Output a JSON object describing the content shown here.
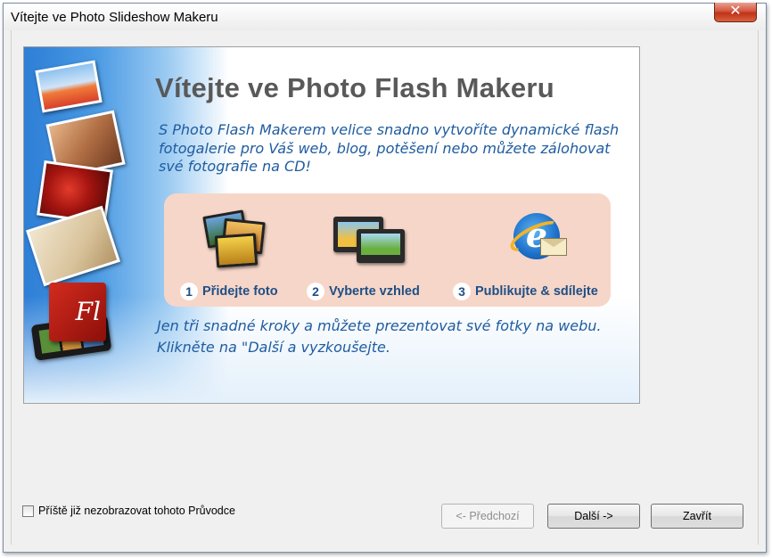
{
  "window": {
    "title": "Vítejte ve Photo Slideshow Makeru",
    "close_glyph": "✕"
  },
  "welcome": {
    "heading": "Vítejte ve Photo Flash Makeru",
    "intro": "S Photo Flash Makerem velice snadno vytvoříte dynamické flash fotogalerie pro Váš web, blog, potěšení nebo můžete zálohovat své fotografie na CD!",
    "outro_line1": "Jen tři snadné kroky a můžete prezentovat své fotky na webu.",
    "outro_line2": "Klikněte na \"Další a vyzkoušejte.",
    "flash_logo": "Fl",
    "ie_logo": "e"
  },
  "steps": [
    {
      "number": "1",
      "label": "Přidejte foto",
      "icon": "photos-icon"
    },
    {
      "number": "2",
      "label": "Vyberte vzhled",
      "icon": "film-screens-icon"
    },
    {
      "number": "3",
      "label": "Publikujte & sdílejte",
      "icon": "ie-mail-icon"
    }
  ],
  "footer": {
    "checkbox_label": "Příště již nezobrazovat tohoto Průvodce",
    "checkbox_checked": false,
    "prev_label": "<- Předchozí",
    "next_label": "Další ->",
    "close_label": "Zavřít"
  }
}
